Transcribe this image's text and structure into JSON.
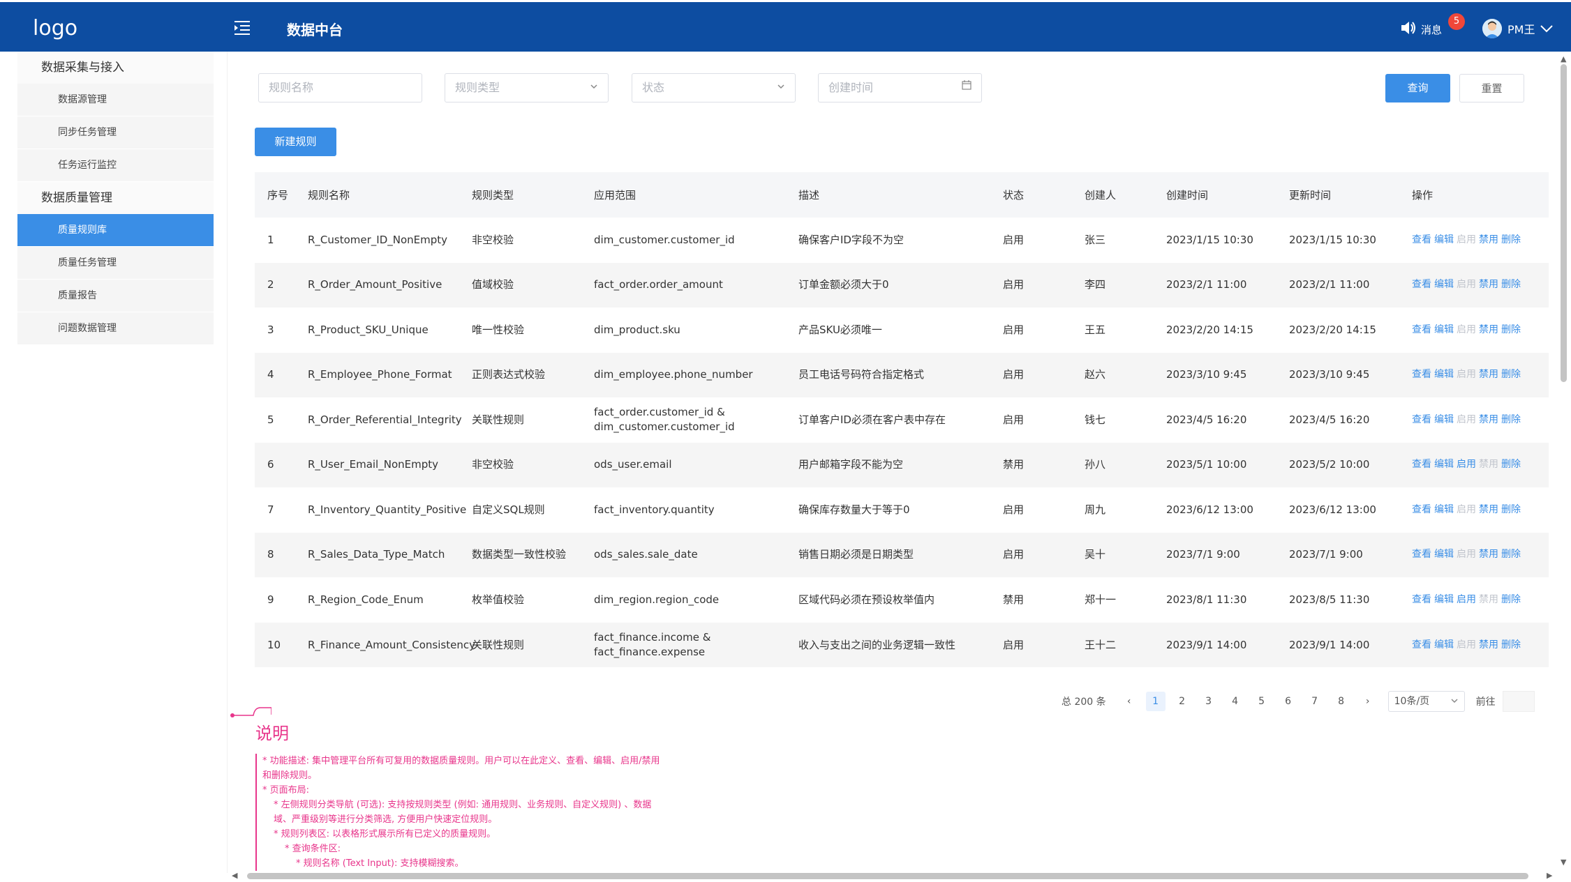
{
  "header": {
    "logo": "logo",
    "title": "数据中台",
    "messages_label": "消息",
    "messages_count": "5",
    "user_name": "PM王"
  },
  "sidebar": {
    "groups": [
      {
        "label": "数据采集与接入",
        "items": [
          "数据源管理",
          "同步任务管理",
          "任务运行监控"
        ]
      },
      {
        "label": "数据质量管理",
        "items": [
          "质量规则库",
          "质量任务管理",
          "质量报告",
          "问题数据管理"
        ]
      }
    ],
    "active_item": "质量规则库"
  },
  "filters": {
    "rule_name_placeholder": "规则名称",
    "rule_type_placeholder": "规则类型",
    "status_placeholder": "状态",
    "created_time_placeholder": "创建时间",
    "query_label": "查询",
    "reset_label": "重置",
    "new_rule_label": "新建规则"
  },
  "table": {
    "columns": [
      "序号",
      "规则名称",
      "规则类型",
      "应用范围",
      "描述",
      "状态",
      "创建人",
      "创建时间",
      "更新时间",
      "操作"
    ],
    "actions": [
      "查看",
      "编辑",
      "启用",
      "禁用",
      "删除"
    ],
    "rows": [
      {
        "no": "1",
        "name": "R_Customer_ID_NonEmpty",
        "type": "非空校验",
        "scope": "dim_customer.customer_id",
        "desc": "确保客户ID字段不为空",
        "status": "启用",
        "creator": "张三",
        "created": "2023/1/15 10:30",
        "updated": "2023/1/15 10:30"
      },
      {
        "no": "2",
        "name": "R_Order_Amount_Positive",
        "type": "值域校验",
        "scope": "fact_order.order_amount",
        "desc": "订单金额必须大于0",
        "status": "启用",
        "creator": "李四",
        "created": "2023/2/1 11:00",
        "updated": "2023/2/1 11:00"
      },
      {
        "no": "3",
        "name": "R_Product_SKU_Unique",
        "type": "唯一性校验",
        "scope": "dim_product.sku",
        "desc": "产品SKU必须唯一",
        "status": "启用",
        "creator": "王五",
        "created": "2023/2/20 14:15",
        "updated": "2023/2/20 14:15"
      },
      {
        "no": "4",
        "name": "R_Employee_Phone_Format",
        "type": "正则表达式校验",
        "scope": "dim_employee.phone_number",
        "desc": "员工电话号码符合指定格式",
        "status": "启用",
        "creator": "赵六",
        "created": "2023/3/10 9:45",
        "updated": "2023/3/10 9:45"
      },
      {
        "no": "5",
        "name": "R_Order_Referential_Integrity",
        "type": "关联性规则",
        "scope": "fact_order.customer_id & dim_customer.customer_id",
        "desc": "订单客户ID必须在客户表中存在",
        "status": "启用",
        "creator": "钱七",
        "created": "2023/4/5 16:20",
        "updated": "2023/4/5 16:20"
      },
      {
        "no": "6",
        "name": "R_User_Email_NonEmpty",
        "type": "非空校验",
        "scope": "ods_user.email",
        "desc": "用户邮箱字段不能为空",
        "status": "禁用",
        "creator": "孙八",
        "created": "2023/5/1 10:00",
        "updated": "2023/5/2 10:00"
      },
      {
        "no": "7",
        "name": "R_Inventory_Quantity_Positive",
        "type": "自定义SQL规则",
        "scope": "fact_inventory.quantity",
        "desc": "确保库存数量大于等于0",
        "status": "启用",
        "creator": "周九",
        "created": "2023/6/12 13:00",
        "updated": "2023/6/12 13:00"
      },
      {
        "no": "8",
        "name": "R_Sales_Data_Type_Match",
        "type": "数据类型一致性校验",
        "scope": "ods_sales.sale_date",
        "desc": "销售日期必须是日期类型",
        "status": "启用",
        "creator": "吴十",
        "created": "2023/7/1 9:00",
        "updated": "2023/7/1 9:00"
      },
      {
        "no": "9",
        "name": "R_Region_Code_Enum",
        "type": "枚举值校验",
        "scope": "dim_region.region_code",
        "desc": "区域代码必须在预设枚举值内",
        "status": "禁用",
        "creator": "郑十一",
        "created": "2023/8/1 11:30",
        "updated": "2023/8/5 11:30"
      },
      {
        "no": "10",
        "name": "R_Finance_Amount_Consistency",
        "type": "关联性规则",
        "scope": "fact_finance.income & fact_finance.expense",
        "desc": "收入与支出之间的业务逻辑一致性",
        "status": "启用",
        "creator": "王十二",
        "created": "2023/9/1 14:00",
        "updated": "2023/9/1 14:00"
      }
    ]
  },
  "pagination": {
    "total": "总 200 条",
    "pages": [
      "1",
      "2",
      "3",
      "4",
      "5",
      "6",
      "7",
      "8"
    ],
    "current": "1",
    "page_size": "10条/页",
    "goto_label": "前往"
  },
  "notes": {
    "title": "说明",
    "lines": [
      {
        "level": 1,
        "text": "* 功能描述: 集中管理平台所有可复用的数据质量规则。用户可以在此定义、查看、编辑、启用/禁用和删除规则。"
      },
      {
        "level": 1,
        "text": "* 页面布局:"
      },
      {
        "level": 2,
        "text": "* 左侧规则分类导航 (可选): 支持按规则类型 (例如: 通用规则、业务规则、自定义规则) 、数据域、严重级别等进行分类筛选, 方便用户快速定位规则。"
      },
      {
        "level": 2,
        "text": "* 规则列表区: 以表格形式展示所有已定义的质量规则。"
      },
      {
        "level": 3,
        "text": "* 查询条件区:"
      },
      {
        "level": 4,
        "text": "* 规则名称 (Text Input): 支持模糊搜索。"
      }
    ]
  },
  "colors": {
    "header_bg": "#0d4da1",
    "primary": "#3a8ee6",
    "notes_pink": "#e8358b",
    "badge_red": "#f0473a"
  }
}
